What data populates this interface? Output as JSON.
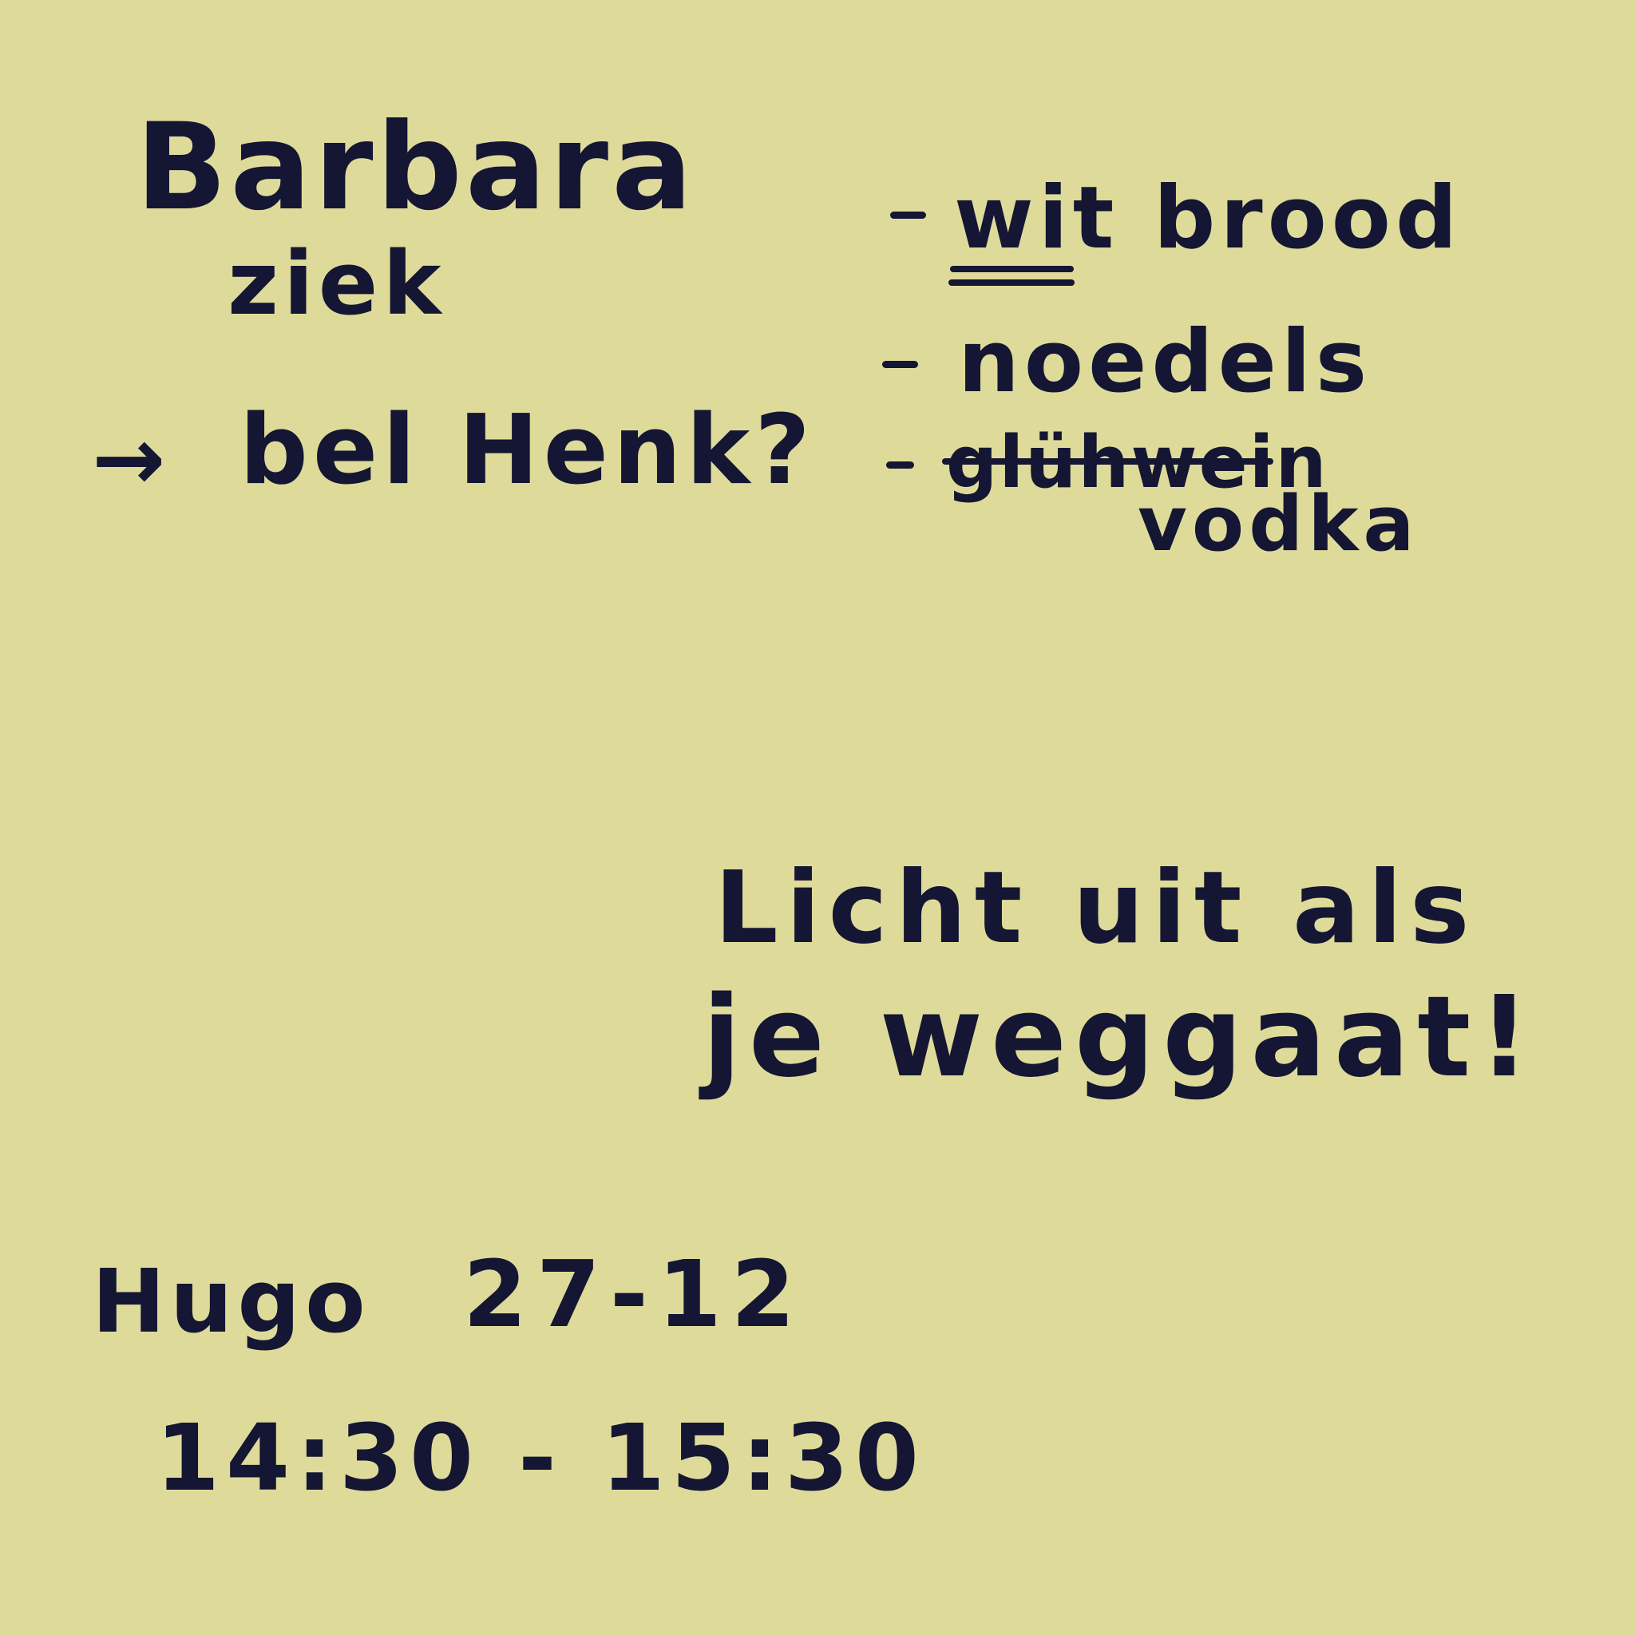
{
  "note": {
    "background_color": "#dedb9a",
    "ink_color": "#141633",
    "top_left": {
      "line1": "Barbara",
      "line2": "ziek",
      "arrow": "→",
      "action": "bel Henk?"
    },
    "shopping_list": {
      "items": [
        {
          "text": "wit brood",
          "emphasis_word": "wit",
          "status": "underlined"
        },
        {
          "text": "noedels",
          "status": "normal"
        },
        {
          "text": "glühwein",
          "status": "crossed-out"
        }
      ],
      "replacement": "vodka"
    },
    "reminder": {
      "line1": "Licht uit als",
      "line2": "je weggaat!"
    },
    "appointment": {
      "name": "Hugo",
      "date": "27-12",
      "time": "14:30 - 15:30"
    }
  }
}
